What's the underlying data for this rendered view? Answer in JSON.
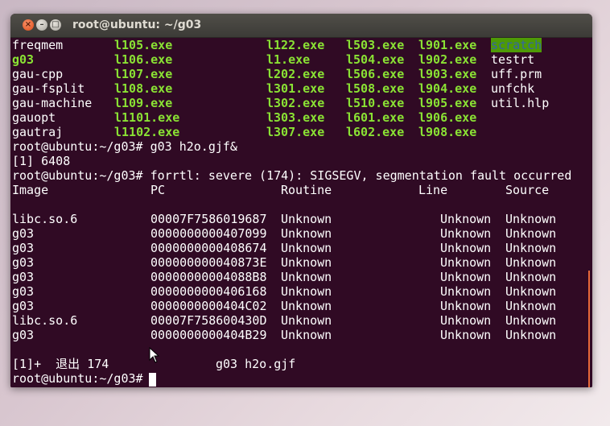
{
  "window": {
    "title": "root@ubuntu: ~/g03",
    "close_glyph": "×",
    "min_glyph": "–",
    "max_glyph": "□"
  },
  "terminal": {
    "listing_rows": [
      [
        "freqmem",
        "l105.exe",
        "l122.exe",
        "l503.exe",
        "l901.exe",
        "scratch"
      ],
      [
        "g03",
        "l106.exe",
        "l1.exe",
        "l504.exe",
        "l902.exe",
        "testrt"
      ],
      [
        "gau-cpp",
        "l107.exe",
        "l202.exe",
        "l506.exe",
        "l903.exe",
        "uff.prm"
      ],
      [
        "gau-fsplit",
        "l108.exe",
        "l301.exe",
        "l508.exe",
        "l904.exe",
        "unfchk"
      ],
      [
        "gau-machine",
        "l109.exe",
        "l302.exe",
        "l510.exe",
        "l905.exe",
        "util.hlp"
      ],
      [
        "gauopt",
        "l1101.exe",
        "l303.exe",
        "l601.exe",
        "l906.exe",
        ""
      ],
      [
        "gautraj",
        "l1102.exe",
        "l307.exe",
        "l602.exe",
        "l908.exe",
        ""
      ]
    ],
    "command_line": "root@ubuntu:~/g03# g03 h2o.gjf&",
    "job_line": "[1] 6408",
    "error_line": "root@ubuntu:~/g03# forrtl: severe (174): SIGSEGV, segmentation fault occurred",
    "trace_headers": [
      "Image",
      "PC",
      "Routine",
      "Line",
      "Source"
    ],
    "trace_rows": [
      [
        "libc.so.6",
        "00007F7586019687",
        "Unknown",
        "Unknown",
        "Unknown"
      ],
      [
        "g03",
        "0000000000407099",
        "Unknown",
        "Unknown",
        "Unknown"
      ],
      [
        "g03",
        "0000000000408674",
        "Unknown",
        "Unknown",
        "Unknown"
      ],
      [
        "g03",
        "000000000040873E",
        "Unknown",
        "Unknown",
        "Unknown"
      ],
      [
        "g03",
        "00000000004088B8",
        "Unknown",
        "Unknown",
        "Unknown"
      ],
      [
        "g03",
        "0000000000406168",
        "Unknown",
        "Unknown",
        "Unknown"
      ],
      [
        "g03",
        "0000000000404C02",
        "Unknown",
        "Unknown",
        "Unknown"
      ],
      [
        "libc.so.6",
        "00007F758600430D",
        "Unknown",
        "Unknown",
        "Unknown"
      ],
      [
        "g03",
        "0000000000404B29",
        "Unknown",
        "Unknown",
        "Unknown"
      ]
    ],
    "exit_job": "[1]+  退出 174",
    "exit_cmd": "g03 h2o.gjf",
    "prompt": "root@ubuntu:~/g03# "
  },
  "colors": {
    "background": "#300a24",
    "executable": "#8ae234",
    "highlight_bg": "#4e9a06",
    "highlight_fg": "#3465a4",
    "text": "#ffffff"
  }
}
